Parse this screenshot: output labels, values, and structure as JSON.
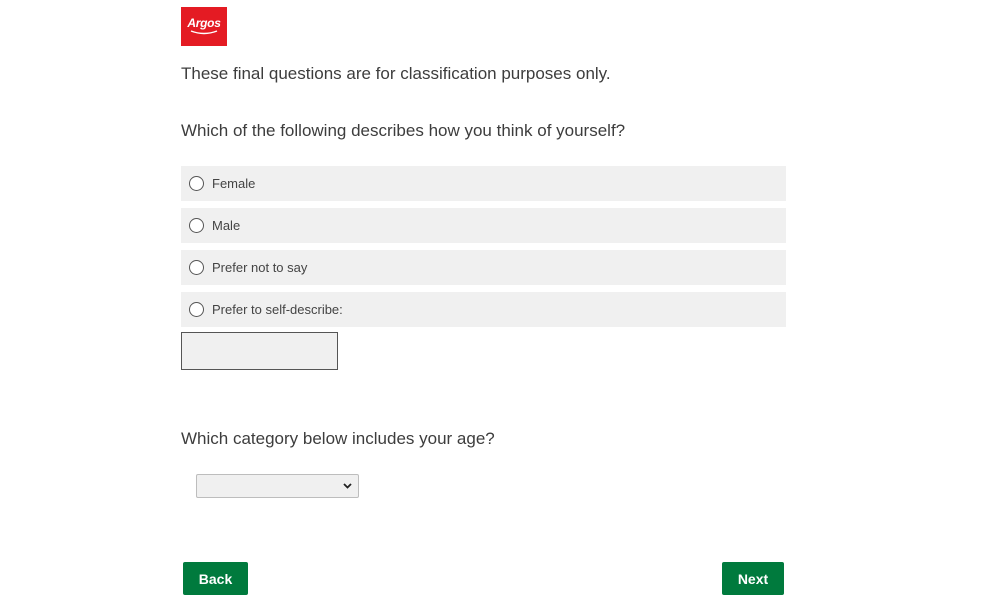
{
  "brand": {
    "logo_text": "Argos",
    "logo_color": "#e41b23"
  },
  "intro_text": "These final questions are for classification purposes only.",
  "gender_question": {
    "text": "Which of the following describes how you think of yourself?",
    "options": [
      {
        "label": "Female",
        "selected": false
      },
      {
        "label": "Male",
        "selected": false
      },
      {
        "label": "Prefer not to say",
        "selected": false
      },
      {
        "label": "Prefer to self-describe:",
        "selected": false
      }
    ],
    "self_describe_value": ""
  },
  "age_question": {
    "text": "Which category below includes your age?",
    "selected_value": ""
  },
  "navigation": {
    "back_label": "Back",
    "next_label": "Next",
    "button_color": "#007a3d"
  },
  "icons": {
    "radio": "radio-unchecked-icon",
    "dropdown": "chevron-down-icon"
  }
}
